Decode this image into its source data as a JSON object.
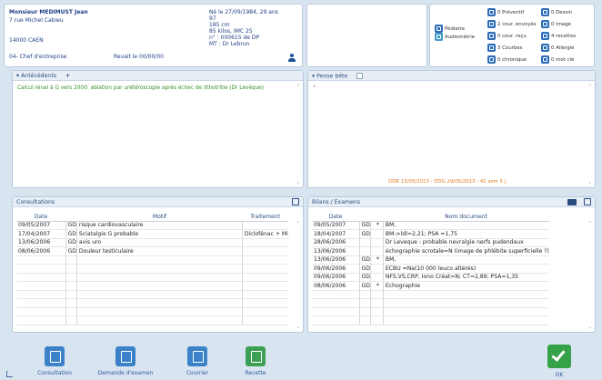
{
  "patient": {
    "name": "Monsieur MEDIMUST Jean",
    "street": "7 rue Michel Cabieu",
    "city": "14000 CAEN",
    "job": "04- Chef d'entreprise",
    "revisit": "Revait le 00/00/00",
    "birth": "Né le 27/09/1984, 29 ans",
    "age_line": "97",
    "height": "185 cm",
    "weight_bmi": "85 kilos, IMC 25",
    "dp": "n° : 000615 de DP",
    "mt": "MT : Dr Lebrun"
  },
  "services": {
    "pediatrie": "Pédiatre",
    "audiometrie": "Audiométrie"
  },
  "indicators": [
    {
      "label": "0 Préventif"
    },
    {
      "label": "0 Dessin"
    },
    {
      "label": "2 cour. envoyés"
    },
    {
      "label": "0 image"
    },
    {
      "label": "0 cour. reçu"
    },
    {
      "label": "4 recettes"
    },
    {
      "label": "3 Courbes"
    },
    {
      "label": "0 Allergie"
    },
    {
      "label": "0 chronique"
    },
    {
      "label": "0 mot clé"
    }
  ],
  "antecedents": {
    "title": "Antécédents",
    "add": "+",
    "text": "Calcul rénal  à G vers 2000: ablation par urétéroscopie après échec de lithotritie (Dr Levêque)"
  },
  "pensebete": {
    "title": "Pense bête",
    "bullet": "•",
    "footer": "DDR 15/05/2013 - DDG 29/05/2013 - 41 sem 5 j"
  },
  "consultations": {
    "title": "Consultations",
    "headers": [
      "Date",
      "Motif",
      "Traitement"
    ],
    "rows": [
      {
        "date": "09/05/2007",
        "doc": "GD",
        "motif": "risque cardiovasculaire",
        "traitement": ""
      },
      {
        "date": "17/04/2007",
        "doc": "GD",
        "motif": "Sciatalgie G probable",
        "traitement": "Diclofénac + Mi"
      },
      {
        "date": "13/06/2006",
        "doc": "GD",
        "motif": "avis uro",
        "traitement": ""
      },
      {
        "date": "08/06/2006",
        "doc": "GD",
        "motif": "Douleur testiculaire",
        "traitement": ""
      }
    ]
  },
  "bilans": {
    "title": "Bilans / Examens",
    "headers": [
      "Date",
      "Nom document"
    ],
    "rows": [
      {
        "date": "09/05/2007",
        "doc": "GD",
        "mark": "*",
        "name": "BM,"
      },
      {
        "date": "18/04/2007",
        "doc": "GD",
        "mark": "",
        "name": "BM->ldl=2,21; PSA =1,75"
      },
      {
        "date": "28/06/2006",
        "doc": "",
        "mark": "",
        "name": "Dr Leveque : probable nevralgie nerfs pudendaux"
      },
      {
        "date": "13/06/2006",
        "doc": "",
        "mark": "",
        "name": "échographie scrotale=N (image de  phlébite superficielle ?)"
      },
      {
        "date": "13/06/2006",
        "doc": "GD",
        "mark": "*",
        "name": "BM,"
      },
      {
        "date": "09/06/2006",
        "doc": "GD",
        "mark": "",
        "name": "ECBU =Na(10 000 leuco altérés)"
      },
      {
        "date": "09/06/2006",
        "doc": "GD",
        "mark": "",
        "name": "NFS,VS,CRP, Iono Créat=N; CT=2,89; PSA=1,35"
      },
      {
        "date": "08/06/2006",
        "doc": "GD",
        "mark": "*",
        "name": "Echographie"
      }
    ]
  },
  "toolbar": {
    "consultation": "Consultation",
    "demande": "Demande d'examen",
    "courrier": "Courrier",
    "recette": "Recette",
    "ok": "OK"
  }
}
